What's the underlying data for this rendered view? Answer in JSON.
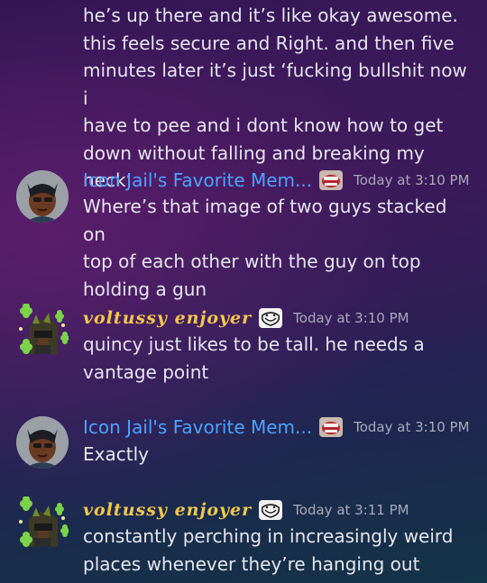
{
  "messages": [
    {
      "continuation": true,
      "lines": [
        "he’s up there and it’s like okay awesome.",
        "this feels secure and Right. and then five",
        "minutes later it’s just ‘fucking bullshit now i",
        "have to pee and i dont know how to get",
        "down without falling and breaking my neck’"
      ]
    },
    {
      "author": "Icon Jail's Favorite Mem...",
      "timestamp": "Today at 3:10 PM",
      "lines": [
        "Where’s that image of two guys stacked on",
        "top of each other with the guy on top",
        "holding a gun"
      ]
    },
    {
      "author": "voltussy enjoyer",
      "timestamp": "Today at 3:10 PM",
      "lines": [
        "quincy just likes to be tall. he needs a",
        "vantage point"
      ]
    },
    {
      "author": "Icon Jail's Favorite Mem...",
      "timestamp": "Today at 3:10 PM",
      "lines": [
        "Exactly"
      ]
    },
    {
      "author": "voltussy enjoyer",
      "timestamp": "Today at 3:11 PM",
      "lines": [
        "constantly perching in increasingly weird",
        "places whenever they’re hanging out"
      ]
    }
  ],
  "colors": {
    "icon_jail_name": "#4ba3ff",
    "voltussy_name": "#f2c84a",
    "timestamp": "#a9a9b9",
    "message_text": "#e6e6ee"
  },
  "icons": {
    "icon_jail_avatar": "horned-character-avatar-icon",
    "icon_jail_badge": "mouth-badge-icon",
    "voltussy_avatar": "clover-character-avatar-icon",
    "voltussy_badge": "trollface-badge-icon"
  }
}
